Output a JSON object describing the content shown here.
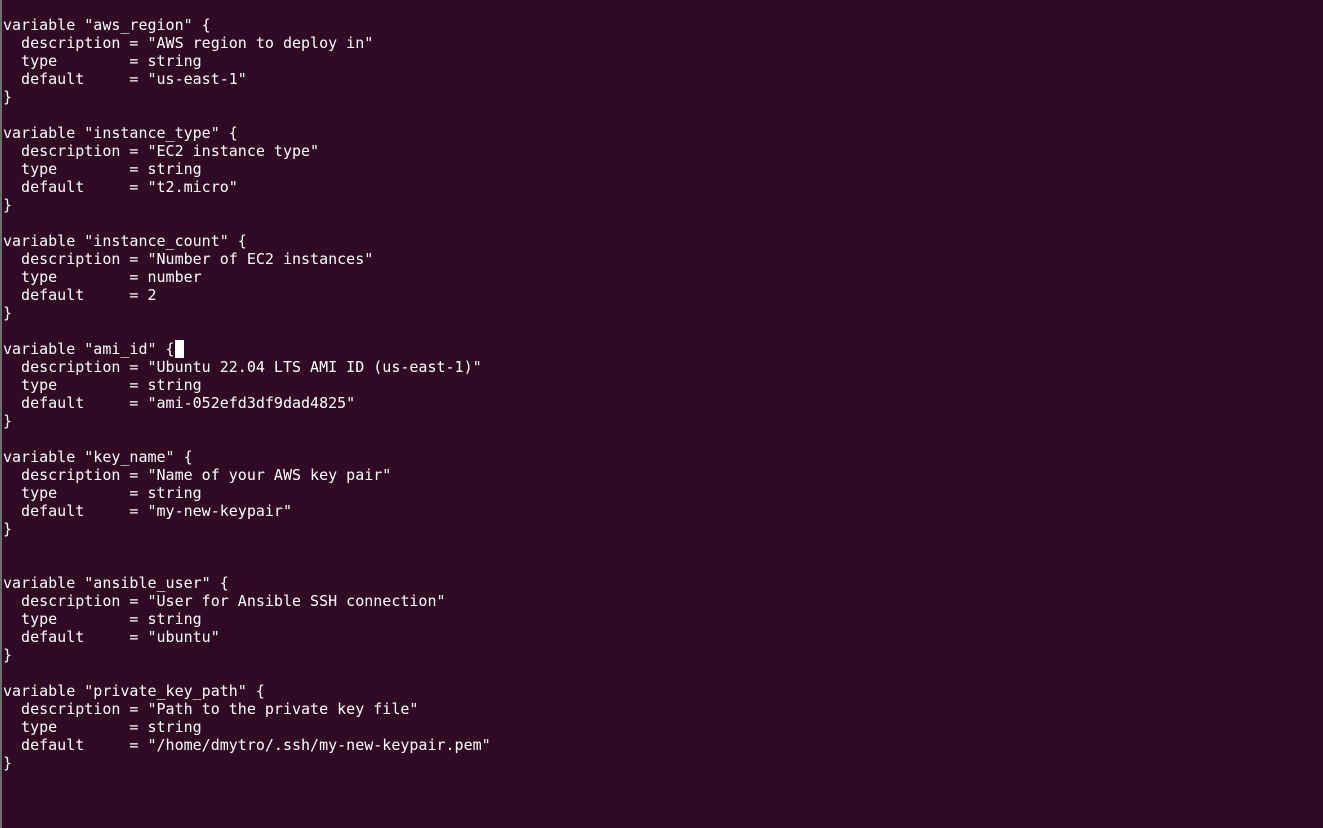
{
  "terminal": {
    "background": "#300a24",
    "foreground": "#ffffff",
    "cursor_line": 18,
    "cursor_col": 19,
    "lines": [
      "variable \"aws_region\" {",
      "  description = \"AWS region to deploy in\"",
      "  type        = string",
      "  default     = \"us-east-1\"",
      "}",
      "",
      "variable \"instance_type\" {",
      "  description = \"EC2 instance type\"",
      "  type        = string",
      "  default     = \"t2.micro\"",
      "}",
      "",
      "variable \"instance_count\" {",
      "  description = \"Number of EC2 instances\"",
      "  type        = number",
      "  default     = 2",
      "}",
      "",
      "variable \"ami_id\" {",
      "  description = \"Ubuntu 22.04 LTS AMI ID (us-east-1)\"",
      "  type        = string",
      "  default     = \"ami-052efd3df9dad4825\"",
      "}",
      "",
      "variable \"key_name\" {",
      "  description = \"Name of your AWS key pair\"",
      "  type        = string",
      "  default     = \"my-new-keypair\"",
      "}",
      "",
      "",
      "variable \"ansible_user\" {",
      "  description = \"User for Ansible SSH connection\"",
      "  type        = string",
      "  default     = \"ubuntu\"",
      "}",
      "",
      "variable \"private_key_path\" {",
      "  description = \"Path to the private key file\"",
      "  type        = string",
      "  default     = \"/home/dmytro/.ssh/my-new-keypair.pem\"",
      "}"
    ]
  }
}
